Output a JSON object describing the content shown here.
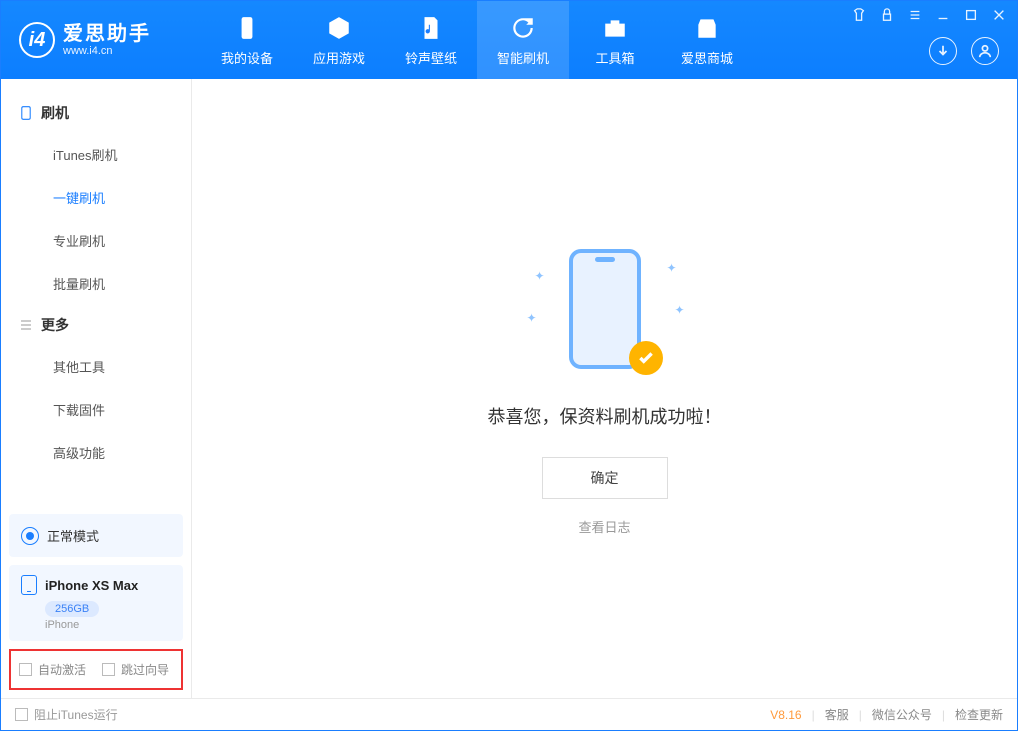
{
  "app": {
    "title": "爱思助手",
    "subtitle": "www.i4.cn"
  },
  "nav": {
    "my_device": "我的设备",
    "apps_games": "应用游戏",
    "ringtones": "铃声壁纸",
    "smart_flash": "智能刷机",
    "toolbox": "工具箱",
    "store": "爱思商城"
  },
  "sidebar": {
    "section_flash": "刷机",
    "items_flash": {
      "itunes": "iTunes刷机",
      "one_click": "一键刷机",
      "pro": "专业刷机",
      "batch": "批量刷机"
    },
    "section_more": "更多",
    "items_more": {
      "other_tools": "其他工具",
      "download_fw": "下载固件",
      "advanced": "高级功能"
    },
    "mode_label": "正常模式",
    "device": {
      "name": "iPhone XS Max",
      "capacity": "256GB",
      "type": "iPhone"
    },
    "opt_auto_activate": "自动激活",
    "opt_skip_wizard": "跳过向导"
  },
  "main": {
    "success_msg": "恭喜您，保资料刷机成功啦！",
    "ok_button": "确定",
    "view_log": "查看日志"
  },
  "footer": {
    "block_itunes": "阻止iTunes运行",
    "version": "V8.16",
    "support": "客服",
    "wechat": "微信公众号",
    "check_update": "检查更新"
  }
}
